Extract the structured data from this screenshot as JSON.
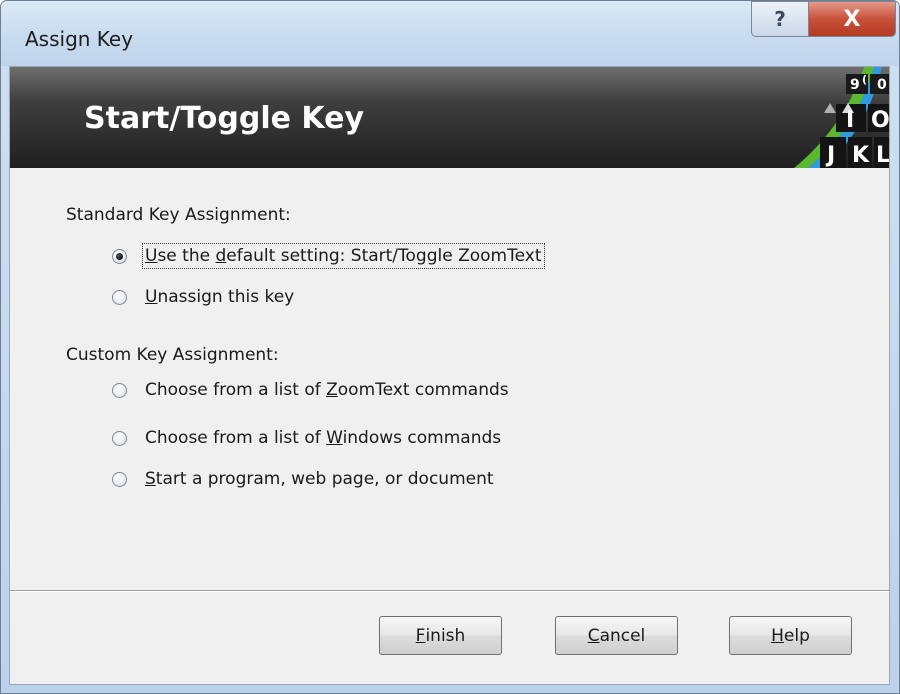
{
  "window": {
    "title": "Assign Key",
    "help_glyph": "?",
    "close_glyph": "X"
  },
  "banner": {
    "title": "Start/Toggle Key",
    "key_letters": [
      "I",
      "O",
      "J",
      "K",
      "L"
    ],
    "key_partial": [
      "9",
      "(",
      "0"
    ]
  },
  "standard": {
    "label": "Standard Key Assignment:",
    "options": [
      {
        "pre": "",
        "mnemonic": "U",
        "post": "se the ",
        "mnemonic2": "d",
        "post2": "efault setting: Start/Toggle ZoomText",
        "checked": true
      },
      {
        "pre": "",
        "mnemonic": "U",
        "post": "nassign this key",
        "checked": false
      }
    ]
  },
  "custom": {
    "label": "Custom Key Assignment:",
    "options": [
      {
        "pre": "Choose from a list of ",
        "mnemonic": "Z",
        "post": "oomText commands",
        "checked": false
      },
      {
        "pre": "Choose from a list of ",
        "mnemonic": "W",
        "post": "indows commands",
        "checked": false
      },
      {
        "pre": "",
        "mnemonic": "S",
        "post": "tart a program, web page, or document",
        "checked": false
      }
    ]
  },
  "buttons": {
    "finish": {
      "mnemonic": "F",
      "rest": "inish"
    },
    "cancel": {
      "mnemonic": "C",
      "rest": "ancel"
    },
    "help": {
      "mnemonic": "H",
      "rest": "elp"
    }
  },
  "colors": {
    "banner_bg": "#2a2a2a",
    "accent_green": "#5cb82e",
    "accent_blue": "#2f9be0",
    "close_red": "#c8513b"
  }
}
